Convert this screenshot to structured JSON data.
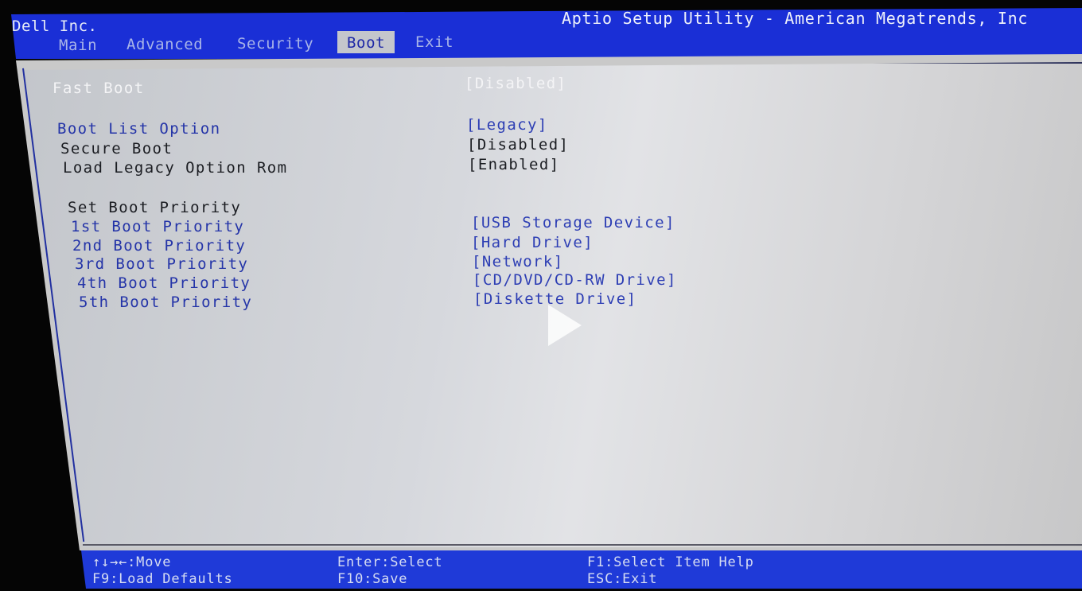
{
  "header": {
    "brand": "Dell Inc.",
    "utility_title": "Aptio Setup Utility - American Megatrends, Inc",
    "tabs": [
      {
        "label": "Main",
        "active": false
      },
      {
        "label": "Advanced",
        "active": false
      },
      {
        "label": "Security",
        "active": false
      },
      {
        "label": "Boot",
        "active": true
      },
      {
        "label": "Exit",
        "active": false
      }
    ]
  },
  "settings": [
    {
      "label": "Fast Boot",
      "value": "[Disabled]",
      "state": "highlighted"
    },
    {
      "label": "Boot List Option",
      "value": "[Legacy]",
      "state": "editable"
    },
    {
      "label": "Secure Boot",
      "value": "[Disabled]",
      "state": "readonly"
    },
    {
      "label": "Load Legacy Option Rom",
      "value": "[Enabled]",
      "state": "readonly"
    }
  ],
  "boot_priority": {
    "heading": "Set Boot Priority",
    "items": [
      {
        "label": "1st Boot Priority",
        "value": "[USB Storage Device]"
      },
      {
        "label": "2nd Boot Priority",
        "value": "[Hard Drive]"
      },
      {
        "label": "3rd Boot Priority",
        "value": "[Network]"
      },
      {
        "label": "4th Boot Priority",
        "value": "[CD/DVD/CD-RW Drive]"
      },
      {
        "label": "5th Boot Priority",
        "value": "[Diskette Drive]"
      }
    ]
  },
  "footer": {
    "move": "↑↓→←:Move",
    "load_defaults": "F9:Load Defaults",
    "select": "Enter:Select",
    "save": "F10:Save",
    "item_help": "F1:Select Item Help",
    "exit": "ESC:Exit"
  },
  "overlay": {
    "icon": "play-icon"
  },
  "colors": {
    "header_blue": "#1a2fd6",
    "footer_blue": "#1f3ad8",
    "panel_gray": "#d6d8dd",
    "option_blue": "#2434a8",
    "active_tab_bg": "#c4c6cc"
  }
}
